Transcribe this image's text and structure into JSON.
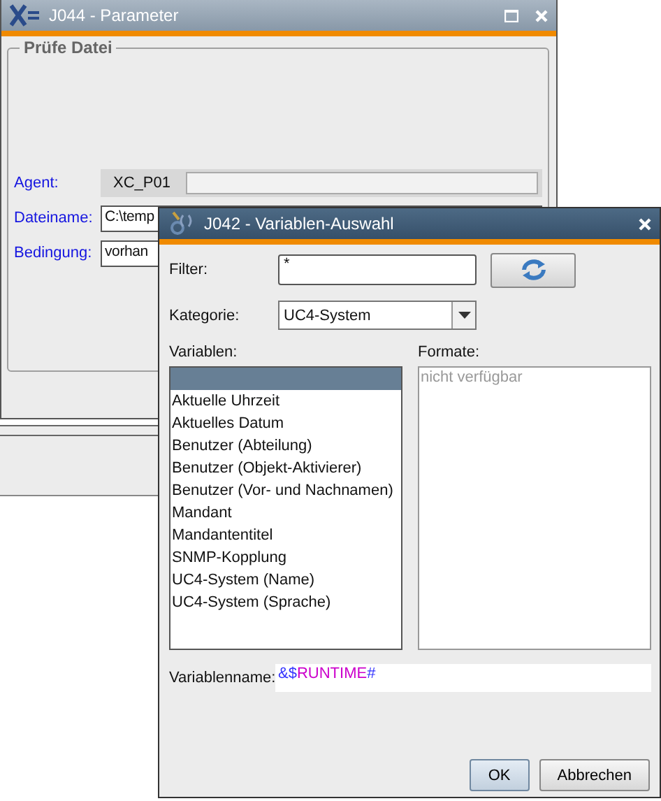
{
  "back_window": {
    "title": "J044 - Parameter",
    "group": {
      "title": "Prüfe Datei",
      "fields": [
        {
          "label": "Agent:",
          "value": "XC_P01",
          "kind": "readonly"
        },
        {
          "label": "Dateiname:",
          "value": "C:\\temp",
          "kind": "input"
        },
        {
          "label": "Bedingung:",
          "value": "vorhan",
          "kind": "input"
        }
      ]
    }
  },
  "dialog": {
    "title": "J042 - Variablen-Auswahl",
    "filter": {
      "label": "Filter:",
      "value": "*"
    },
    "category": {
      "label": "Kategorie:",
      "value": "UC4-System"
    },
    "variables": {
      "label": "Variablen:",
      "items": [
        {
          "selected": true
        },
        {
          "label": "Aktuelle Uhrzeit",
          "selected": false
        },
        {
          "label": "Aktuelles Datum",
          "selected": false
        },
        {
          "label": "Benutzer (Abteilung)",
          "selected": false
        },
        {
          "label": "Benutzer (Objekt-Aktivierer)",
          "selected": false
        },
        {
          "label": "Benutzer (Vor- und Nachnamen)",
          "selected": false
        },
        {
          "label": "Mandant",
          "selected": false
        },
        {
          "label": "Mandantentitel",
          "selected": false
        },
        {
          "label": "SNMP-Kopplung",
          "selected": false
        },
        {
          "label": "UC4-System (Name)",
          "selected": false
        },
        {
          "label": "UC4-System (Sprache)",
          "selected": false
        }
      ]
    },
    "formats": {
      "label": "Formate:",
      "placeholder": "nicht verfügbar"
    },
    "variable_name": {
      "label": "Variablenname:",
      "segments": [
        {
          "text": "&$",
          "color": "#3333ff"
        },
        {
          "text": "RUNTIME",
          "color": "#cc00cc"
        },
        {
          "text": "#",
          "color": "#3333ff"
        }
      ]
    },
    "buttons": [
      "OK",
      "Abbrechen"
    ]
  }
}
